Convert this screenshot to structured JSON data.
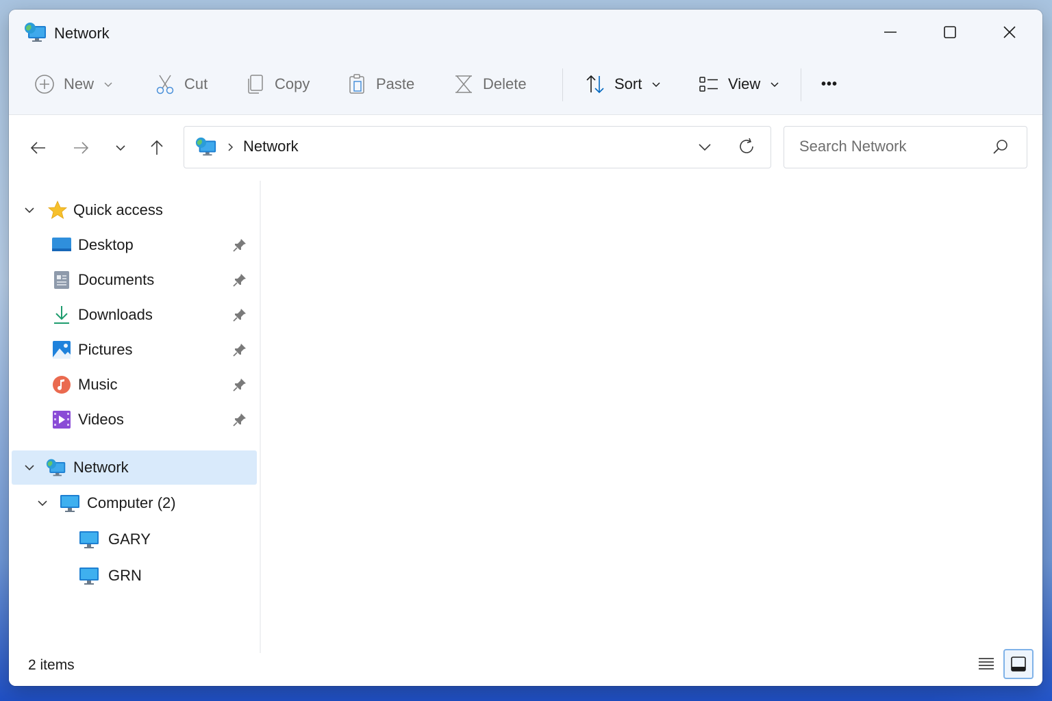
{
  "window": {
    "title": "Network",
    "icon": "network-icon"
  },
  "toolbar": {
    "new_label": "New",
    "cut_label": "Cut",
    "copy_label": "Copy",
    "paste_label": "Paste",
    "delete_label": "Delete",
    "sort_label": "Sort",
    "view_label": "View",
    "more_label": "•••"
  },
  "address": {
    "location": "Network"
  },
  "search": {
    "placeholder": "Search Network"
  },
  "sidebar": {
    "quick_access": "Quick access",
    "items": [
      {
        "label": "Desktop",
        "icon": "desktop-icon",
        "pinned": true
      },
      {
        "label": "Documents",
        "icon": "documents-icon",
        "pinned": true
      },
      {
        "label": "Downloads",
        "icon": "downloads-icon",
        "pinned": true
      },
      {
        "label": "Pictures",
        "icon": "pictures-icon",
        "pinned": true
      },
      {
        "label": "Music",
        "icon": "music-icon",
        "pinned": true
      },
      {
        "label": "Videos",
        "icon": "videos-icon",
        "pinned": true
      }
    ],
    "network": "Network",
    "computer_group": "Computer (2)",
    "computers": [
      "GARY",
      "GRN"
    ]
  },
  "status": {
    "items_count": "2 items"
  },
  "colors": {
    "selected_bg": "#d9eafb",
    "accent": "#0067c0",
    "chrome_bg": "#f3f6fb"
  }
}
